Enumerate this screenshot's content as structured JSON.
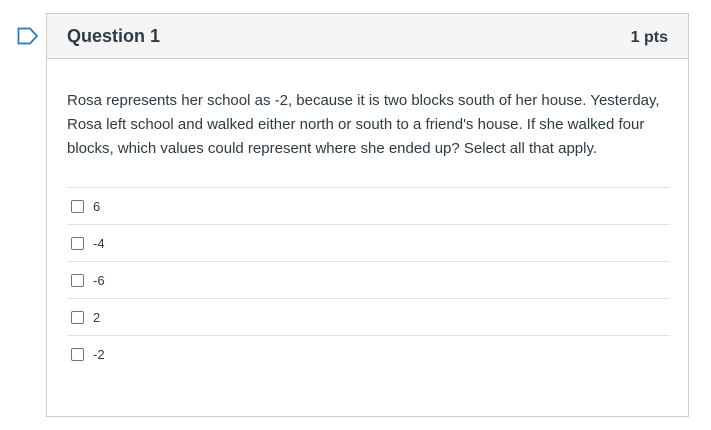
{
  "question": {
    "title": "Question 1",
    "points": "1 pts",
    "text": "Rosa represents her school as -2, because it is two blocks south of her house. Yesterday, Rosa left school and walked either north or south to a friend's house. If she walked four blocks, which values could represent where she ended up? Select all that apply.",
    "answers": [
      {
        "label": "6",
        "checked": false
      },
      {
        "label": "-4",
        "checked": false
      },
      {
        "label": "-6",
        "checked": false
      },
      {
        "label": "2",
        "checked": false
      },
      {
        "label": "-2",
        "checked": false
      }
    ]
  },
  "icons": {
    "flag": "flag-outline-icon"
  },
  "colors": {
    "flag_accent": "#2b7abc",
    "header_bg": "#f5f5f5",
    "border": "#c7cdd1",
    "text": "#2d3b45"
  }
}
